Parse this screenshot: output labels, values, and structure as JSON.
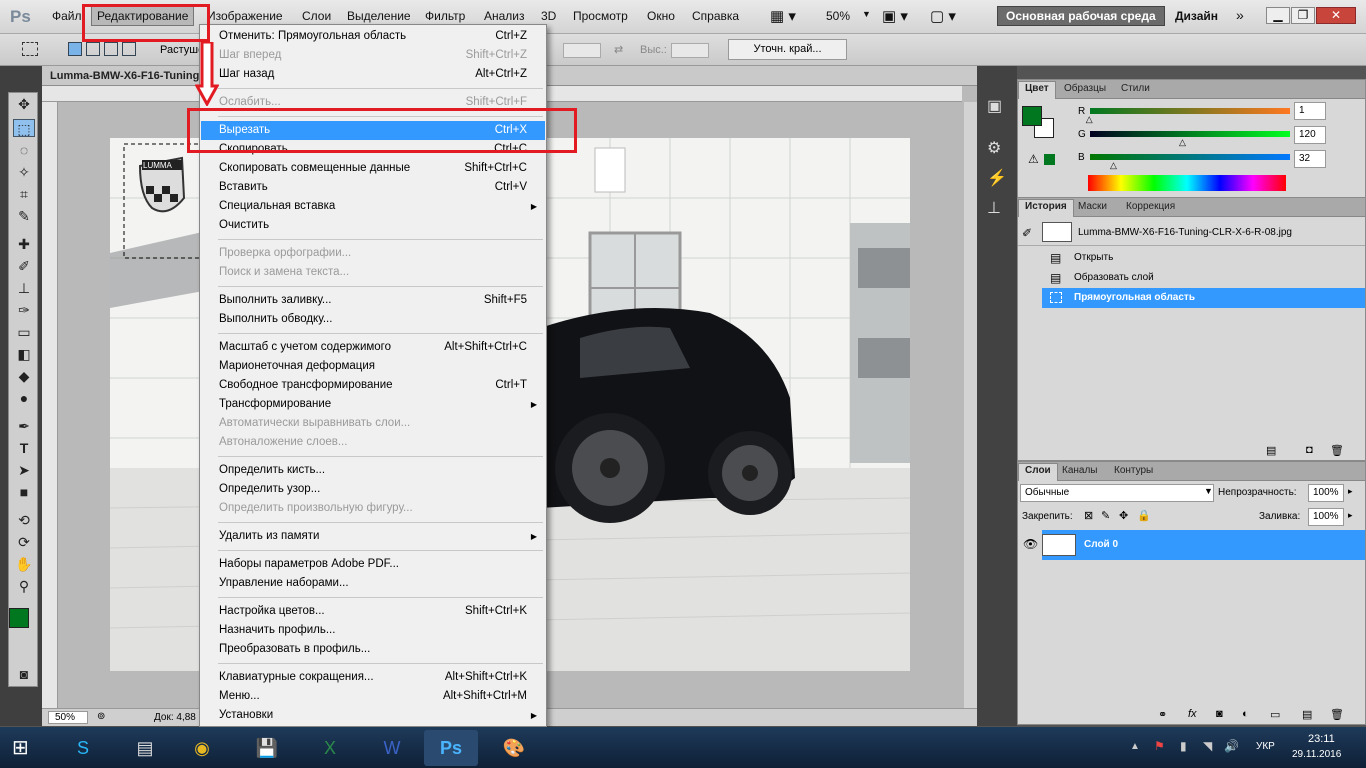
{
  "app": {
    "logo": "Ps"
  },
  "menubar": {
    "items": [
      "Файл",
      "Редактирование",
      "Изображение",
      "Слои",
      "Выделение",
      "Фильтр",
      "Анализ",
      "3D",
      "Просмотр",
      "Окно",
      "Справка"
    ],
    "zoom": "50%",
    "workspace_button": "Основная рабочая среда",
    "design_label": "Дизайн"
  },
  "options": {
    "mode_label": "Растуше",
    "height_label": "Выс.:",
    "refine_button": "Уточн. край..."
  },
  "document": {
    "tab_title": "Lumma-BMW-X6-F16-Tuning",
    "status_zoom": "50%",
    "status_doc": "Док: 4,88"
  },
  "edit_menu": {
    "groups": [
      [
        {
          "label": "Отменить: Прямоугольная область",
          "shortcut": "Ctrl+Z",
          "disabled": false
        },
        {
          "label": "Шаг вперед",
          "shortcut": "Shift+Ctrl+Z",
          "disabled": true
        },
        {
          "label": "Шаг назад",
          "shortcut": "Alt+Ctrl+Z",
          "disabled": false
        }
      ],
      [
        {
          "label": "Ослабить...",
          "shortcut": "Shift+Ctrl+F",
          "disabled": true
        }
      ],
      [
        {
          "label": "Вырезать",
          "shortcut": "Ctrl+X",
          "disabled": false,
          "highlighted": true
        },
        {
          "label": "Скопировать",
          "shortcut": "Ctrl+C",
          "disabled": false
        },
        {
          "label": "Скопировать совмещенные данные",
          "shortcut": "Shift+Ctrl+C",
          "disabled": false
        },
        {
          "label": "Вставить",
          "shortcut": "Ctrl+V",
          "disabled": false
        },
        {
          "label": "Специальная вставка",
          "shortcut": "",
          "disabled": false,
          "submenu": true
        },
        {
          "label": "Очистить",
          "shortcut": "",
          "disabled": false
        }
      ],
      [
        {
          "label": "Проверка орфографии...",
          "shortcut": "",
          "disabled": true
        },
        {
          "label": "Поиск и замена текста...",
          "shortcut": "",
          "disabled": true
        }
      ],
      [
        {
          "label": "Выполнить заливку...",
          "shortcut": "Shift+F5",
          "disabled": false
        },
        {
          "label": "Выполнить обводку...",
          "shortcut": "",
          "disabled": false
        }
      ],
      [
        {
          "label": "Масштаб с учетом содержимого",
          "shortcut": "Alt+Shift+Ctrl+C",
          "disabled": false
        },
        {
          "label": "Марионеточная деформация",
          "shortcut": "",
          "disabled": false
        },
        {
          "label": "Свободное трансформирование",
          "shortcut": "Ctrl+T",
          "disabled": false
        },
        {
          "label": "Трансформирование",
          "shortcut": "",
          "disabled": false,
          "submenu": true
        },
        {
          "label": "Автоматически выравнивать слои...",
          "shortcut": "",
          "disabled": true
        },
        {
          "label": "Автоналожение слоев...",
          "shortcut": "",
          "disabled": true
        }
      ],
      [
        {
          "label": "Определить кисть...",
          "shortcut": "",
          "disabled": false
        },
        {
          "label": "Определить узор...",
          "shortcut": "",
          "disabled": false
        },
        {
          "label": "Определить произвольную фигуру...",
          "shortcut": "",
          "disabled": true
        }
      ],
      [
        {
          "label": "Удалить из памяти",
          "shortcut": "",
          "disabled": false,
          "submenu": true
        }
      ],
      [
        {
          "label": "Наборы параметров Adobe PDF...",
          "shortcut": "",
          "disabled": false
        },
        {
          "label": "Управление наборами...",
          "shortcut": "",
          "disabled": false
        }
      ],
      [
        {
          "label": "Настройка цветов...",
          "shortcut": "Shift+Ctrl+K",
          "disabled": false
        },
        {
          "label": "Назначить профиль...",
          "shortcut": "",
          "disabled": false
        },
        {
          "label": "Преобразовать в профиль...",
          "shortcut": "",
          "disabled": false
        }
      ],
      [
        {
          "label": "Клавиатурные сокращения...",
          "shortcut": "Alt+Shift+Ctrl+K",
          "disabled": false
        },
        {
          "label": "Меню...",
          "shortcut": "Alt+Shift+Ctrl+M",
          "disabled": false
        },
        {
          "label": "Установки",
          "shortcut": "",
          "disabled": false,
          "submenu": true
        }
      ]
    ]
  },
  "color_panel": {
    "tabs": [
      "Цвет",
      "Образцы",
      "Стили"
    ],
    "r_label": "R",
    "g_label": "G",
    "b_label": "B",
    "r": "1",
    "g": "120",
    "b": "32",
    "r_level": 0.004,
    "g_level": 0.47,
    "b_level": 0.125,
    "foreground": "#017820"
  },
  "history_panel": {
    "tabs": [
      "История",
      "Маски",
      "Коррекция"
    ],
    "snapshot": "Lumma-BMW-X6-F16-Tuning-CLR-X-6-R-08.jpg",
    "steps": [
      "Открыть",
      "Образовать слой",
      "Прямоугольная область"
    ]
  },
  "layers_panel": {
    "tabs": [
      "Слои",
      "Каналы",
      "Контуры"
    ],
    "blend_mode": "Обычные",
    "opacity_label": "Непрозрачность:",
    "opacity": "100%",
    "lock_label": "Закрепить:",
    "fill_label": "Заливка:",
    "fill": "100%",
    "layer_name": "Слой 0"
  },
  "image": {
    "brand": "LUMMA"
  },
  "taskbar": {
    "lang": "УКР",
    "time": "23:11",
    "date": "29.11.2016"
  },
  "colors": {
    "accent": "#3399ff",
    "annotation": "#e21b22"
  }
}
